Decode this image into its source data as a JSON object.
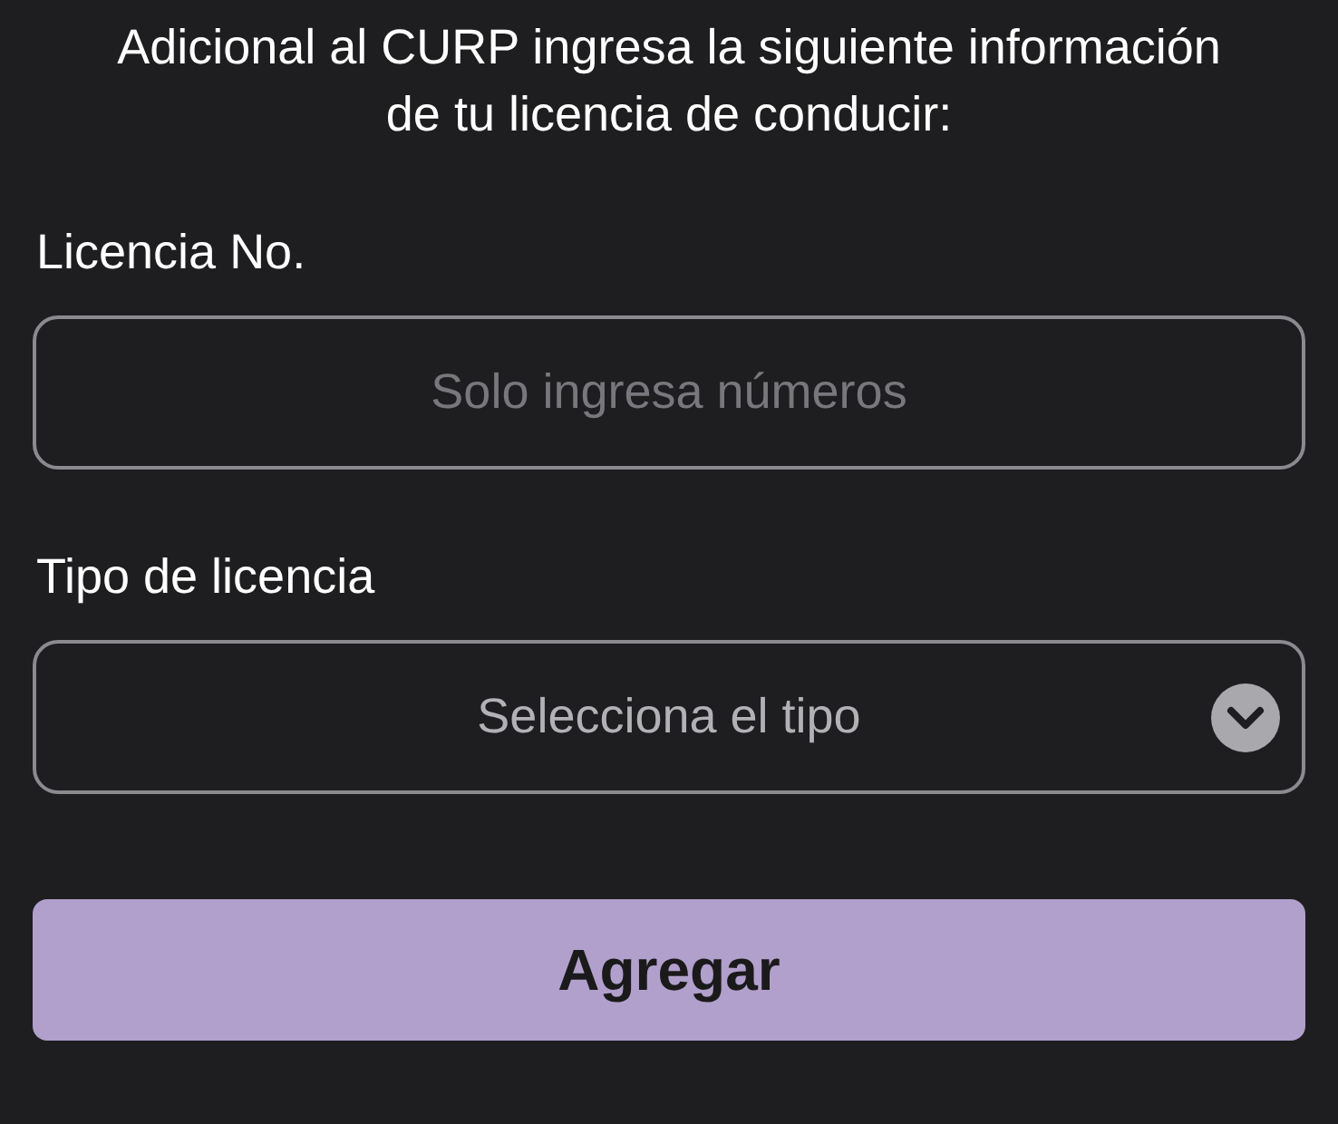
{
  "instructions": "Adicional al CURP ingresa la siguiente información de tu licencia de conducir:",
  "fields": [
    {
      "kind": "text",
      "label": "Licencia No.",
      "placeholder": "Solo ingresa números"
    },
    {
      "kind": "select",
      "label": "Tipo de licencia",
      "placeholder": "Selecciona el tipo"
    }
  ],
  "submit_button": {
    "label": "Agregar"
  }
}
